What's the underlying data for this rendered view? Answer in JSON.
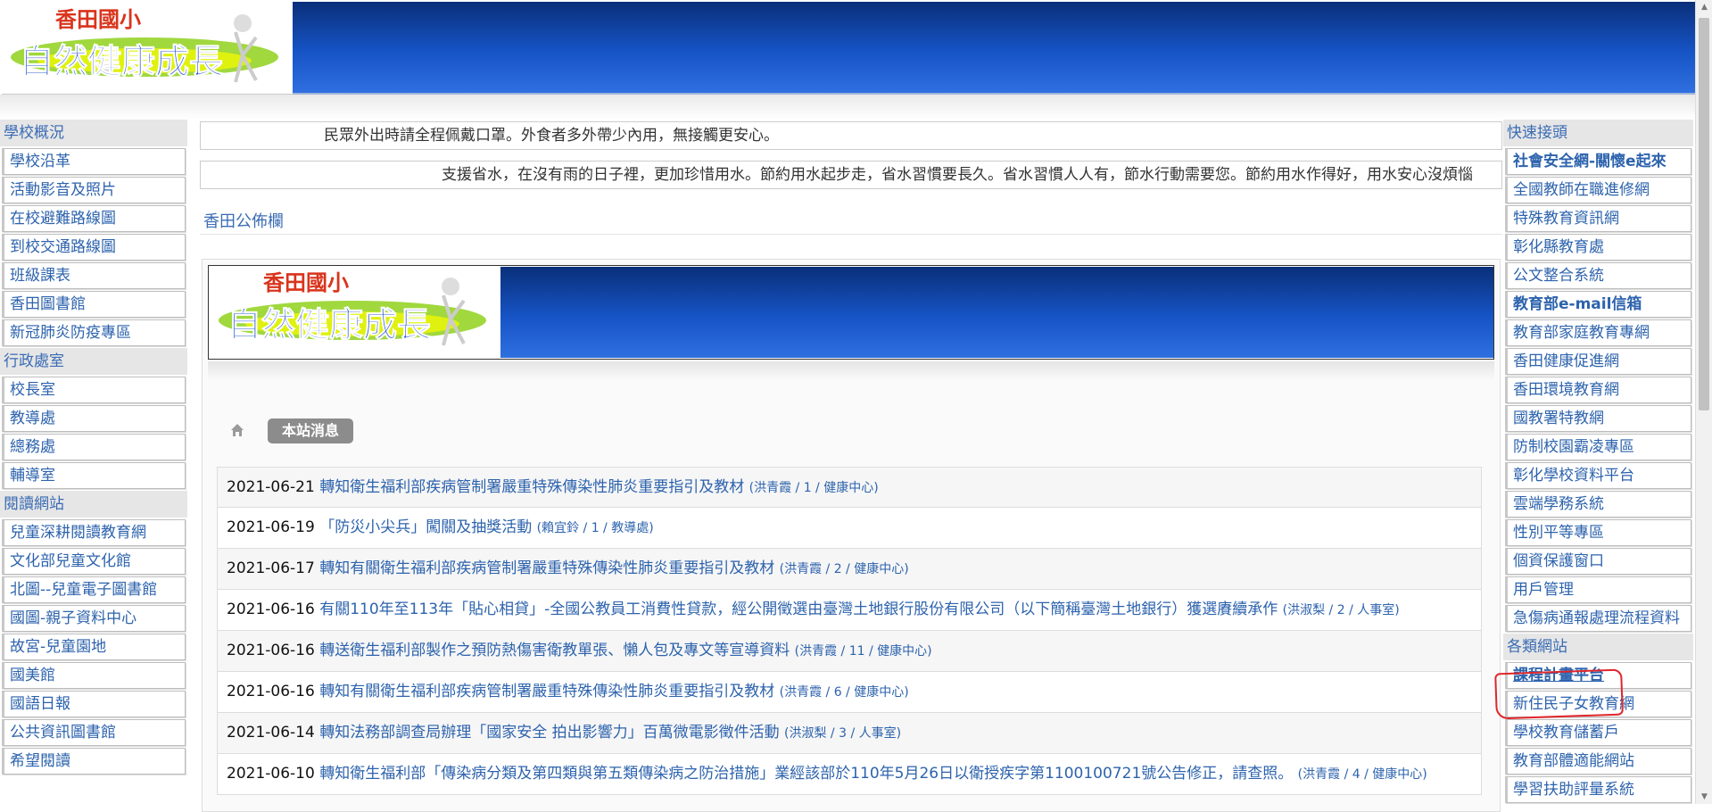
{
  "colors": {
    "banner_blue": "#1654c6",
    "link": "#2d63ad",
    "section_head": "#3b6cb4",
    "highlight": "#e0262b"
  },
  "logo": {
    "school": "香田國小",
    "slogan": "自然健康成長"
  },
  "marquee": {
    "line1": "民眾外出時請全程佩戴口罩。外食者多外帶少內用，無接觸更安心。",
    "line2": "支援省水，在沒有雨的日子裡，更加珍惜用水。節約用水起步走，省水習慣要長久。省水習慣人人有，節水行動需要您。節約用水作得好，用水安心沒煩惱"
  },
  "board_title": "香田公佈欄",
  "breadcrumb": {
    "home_icon": "home-icon",
    "current": "本站消息"
  },
  "left_sidebar": [
    {
      "title": "學校概況",
      "items": [
        "學校沿革",
        "活動影音及照片",
        "在校避難路線圖",
        "到校交通路線圖",
        "班級課表",
        "香田圖書館",
        "新冠肺炎防疫專區"
      ]
    },
    {
      "title": "行政處室",
      "items": [
        "校長室",
        "教導處",
        "總務處",
        "輔導室"
      ]
    },
    {
      "title": "閱讀網站",
      "items": [
        "兒童深耕閱讀教育網",
        "文化部兒童文化館",
        "北圖--兒童電子圖書館",
        "國圖-親子資料中心",
        "故宮-兒童園地",
        "國美館",
        "國語日報",
        "公共資訊圖書館",
        "希望閱讀"
      ]
    }
  ],
  "right_sidebar": [
    {
      "title": "快速接頭",
      "items": [
        "社會安全網-關懷e起來",
        "全國教師在職進修網",
        "特殊教育資訊網",
        "彰化縣教育處",
        "公文整合系統",
        "教育部e-mail信箱",
        "教育部家庭教育專網",
        "香田健康促進網",
        "香田環境教育網",
        "國教署特教網",
        "防制校園霸凌專區",
        "彰化學校資料平台",
        "雲端學務系統",
        "性別平等專區",
        "個資保護窗口",
        "用戶管理",
        "急傷病通報處理流程資料"
      ]
    },
    {
      "title": "各類網站",
      "items": [
        "課程計畫平台",
        "新住民子女教育網",
        "學校教育儲蓄戶",
        "教育部體適能網站",
        "學習扶助評量系統"
      ]
    }
  ],
  "news": [
    {
      "date": "2021-06-21",
      "title": "轉知衛生福利部疾病管制署嚴重特殊傳染性肺炎重要指引及教材",
      "meta": "(洪青霞 / 1 / 健康中心)"
    },
    {
      "date": "2021-06-19",
      "title": "「防災小尖兵」闖關及抽獎活動",
      "meta": "(賴宜鈴 / 1 / 教導處)"
    },
    {
      "date": "2021-06-17",
      "title": "轉知有關衛生福利部疾病管制署嚴重特殊傳染性肺炎重要指引及教材",
      "meta": "(洪青霞 / 2 / 健康中心)"
    },
    {
      "date": "2021-06-16",
      "title": "有關110年至113年「貼心相貸」-全國公教員工消費性貸款，經公開徵選由臺灣土地銀行股份有限公司（以下簡稱臺灣土地銀行）獲選賡續承作",
      "meta": "(洪淑梨 / 2 / 人事室)"
    },
    {
      "date": "2021-06-16",
      "title": "轉送衛生福利部製作之預防熱傷害衛教單張、懶人包及專文等宣導資料",
      "meta": "(洪青霞 / 11 / 健康中心)"
    },
    {
      "date": "2021-06-16",
      "title": "轉知有關衛生福利部疾病管制署嚴重特殊傳染性肺炎重要指引及教材",
      "meta": "(洪青霞 / 6 / 健康中心)"
    },
    {
      "date": "2021-06-14",
      "title": "轉知法務部調查局辦理「國家安全 拍出影響力」百萬微電影徵件活動",
      "meta": "(洪淑梨 / 3 / 人事室)"
    },
    {
      "date": "2021-06-10",
      "title": "轉知衛生福利部「傳染病分類及第四類與第五類傳染病之防治措施」業經該部於110年5月26日以衛授疾字第1100100721號公告修正，請查照。",
      "meta": "(洪青霞 / 4 / 健康中心)"
    }
  ]
}
